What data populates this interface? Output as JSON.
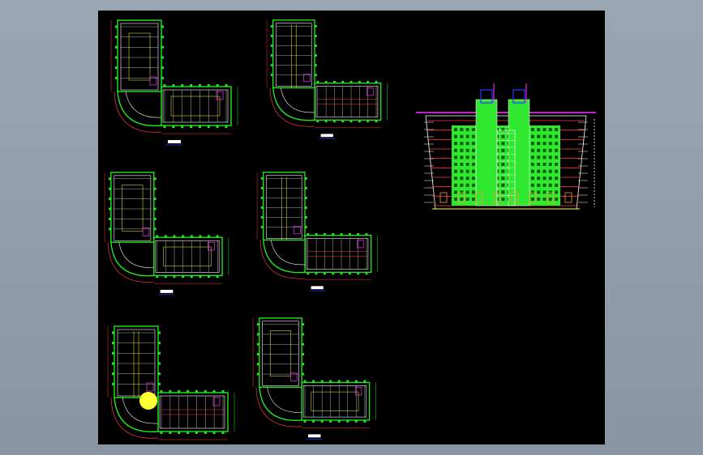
{
  "viewer": {
    "background": "#000000",
    "frame_color": "#8d99a7"
  },
  "palette": {
    "wall": "#1fe81f",
    "outline": "#ffffff",
    "partition": "#ffff33",
    "accent": "#ff3b3b",
    "magenta": "#ff33ff",
    "blue": "#2a3bff",
    "elevation_fill": "#2fe82f"
  },
  "plans": [
    {
      "id": "plan-1",
      "label": "",
      "has_circle": false
    },
    {
      "id": "plan-2",
      "label": "",
      "has_circle": false
    },
    {
      "id": "plan-3",
      "label": "",
      "has_circle": false
    },
    {
      "id": "plan-4",
      "label": "",
      "has_circle": false
    },
    {
      "id": "plan-5",
      "label": "",
      "has_circle": true
    },
    {
      "id": "plan-6",
      "label": "",
      "has_circle": false
    }
  ],
  "elevation": {
    "id": "front-elevation",
    "towers": 2,
    "floors": 9
  }
}
